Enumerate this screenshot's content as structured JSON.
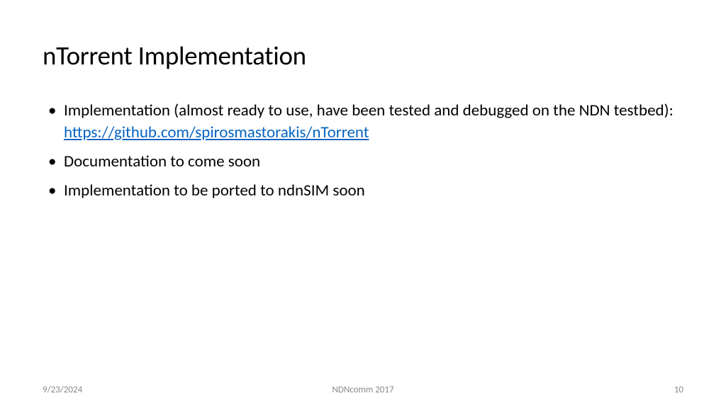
{
  "title": "nTorrent Implementation",
  "bullets": [
    {
      "text": "Implementation (almost ready to use, have been tested and debugged on the NDN testbed):",
      "link": "https://github.com/spirosmastorakis/nTorrent"
    },
    {
      "text": "Documentation to come soon"
    },
    {
      "text": "Implementation to be ported to ndnSIM soon"
    }
  ],
  "footer": {
    "date": "9/23/2024",
    "center": "NDNcomm 2017",
    "page": "10"
  }
}
